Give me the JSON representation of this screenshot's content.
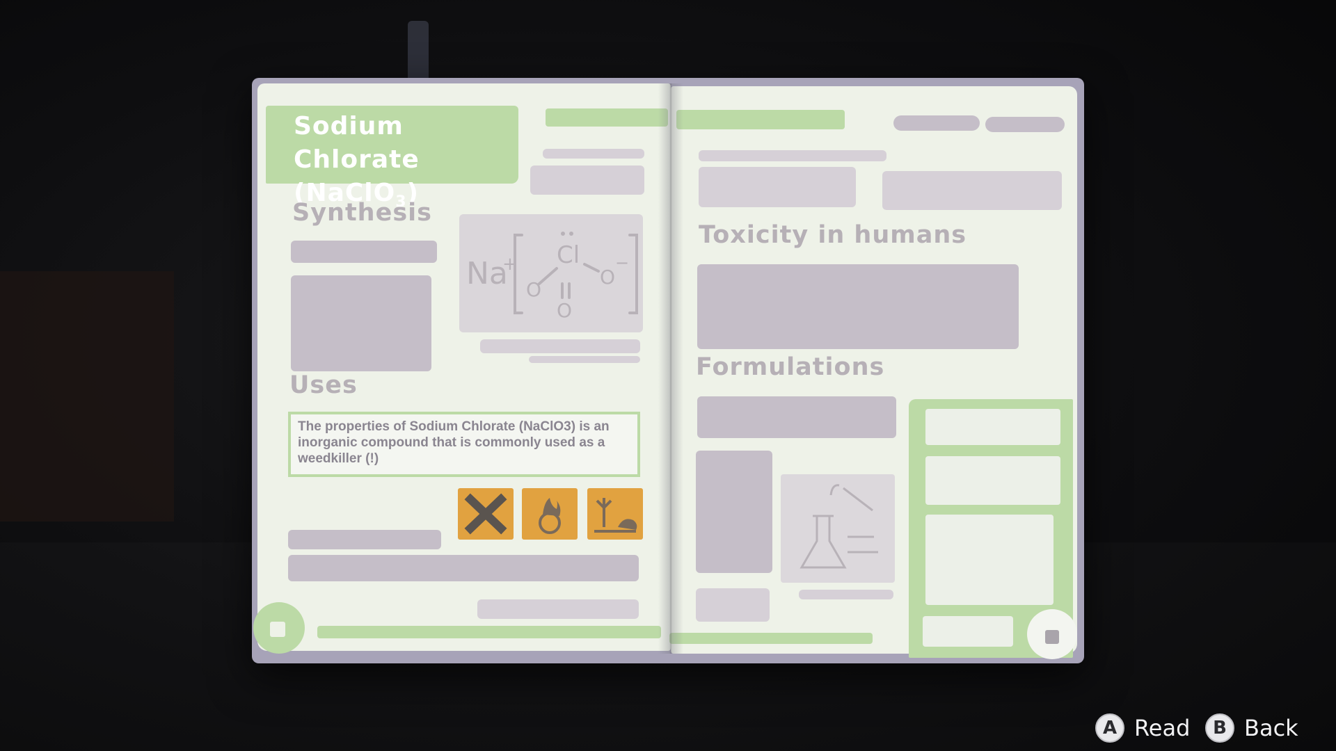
{
  "book": {
    "title": "Sodium Chlorate",
    "formula_prefix": "(NaClO",
    "formula_sub": "3",
    "formula_suffix": ")",
    "sections": {
      "synthesis": "Synthesis",
      "uses": "Uses",
      "toxicity": "Toxicity in humans",
      "formulations": "Formulations"
    },
    "uses_text": "The properties of Sodium Chlorate (NaClO3) is an inorganic compound that is commonly used as a weedkiller (!)",
    "molecule": {
      "cation": "Na",
      "cation_charge": "+",
      "center": "Cl",
      "oxygen": "O",
      "anion_charge": "−"
    },
    "hazard_icons": [
      "harmful-x-icon",
      "oxidizer-flame-icon",
      "environment-hazard-icon"
    ]
  },
  "prompts": [
    {
      "button": "A",
      "label": "Read"
    },
    {
      "button": "B",
      "label": "Back"
    }
  ],
  "colors": {
    "accent_green": "#bcdaa6",
    "page": "#eef2e8",
    "redaction": "#c5bec8",
    "hazard_orange": "#e1a240"
  }
}
